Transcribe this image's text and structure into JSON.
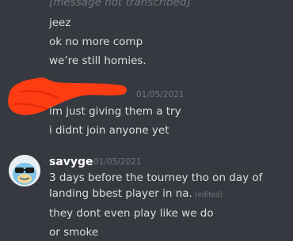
{
  "top_messages": [
    "[message not transcribed]",
    "jeez",
    "ok no more comp",
    "we’re still homies."
  ],
  "redacted_group": {
    "timestamp": "01/05/2021",
    "messages": [
      "im just giving them a try",
      "i didnt join anyone yet"
    ]
  },
  "savyge_group": {
    "username": "savyge",
    "timestamp": "01/05/2021",
    "message1_line1": "3 days before the tourney tho on day of",
    "message1_line2": "landing bbest player in na.",
    "edited_label": "(edited)",
    "messages": [
      "they dont even play like we do",
      "or smoke"
    ]
  },
  "colors": {
    "background": "#36393f",
    "text": "#dcddde",
    "muted": "#72767d",
    "username": "#ffffff",
    "redaction": "#ff3b12"
  },
  "icons": {
    "avatar": "squirtle-sunglasses-avatar"
  }
}
